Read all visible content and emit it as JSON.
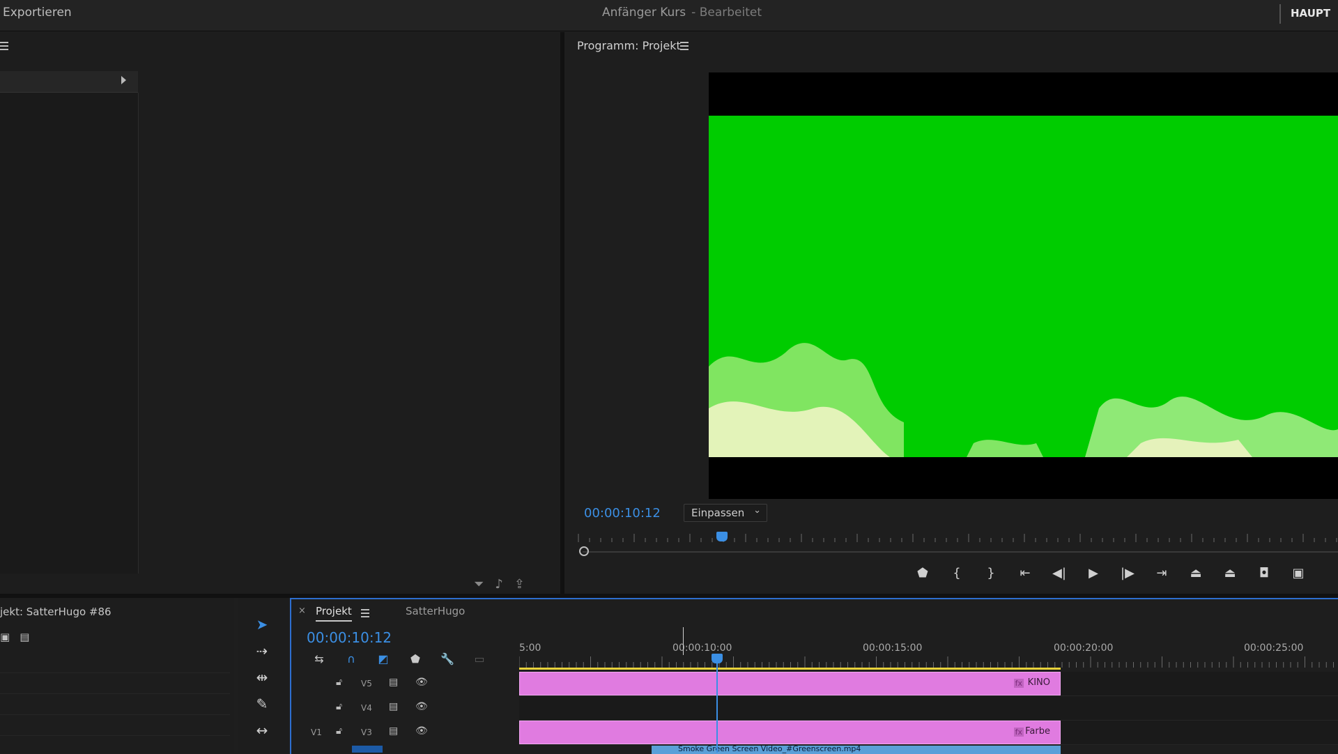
{
  "topbar": {
    "export_label": "Exportieren",
    "project_title": "Anfänger Kurs",
    "project_status": "- Bearbeitet",
    "workspace": "HAUPT"
  },
  "program_monitor": {
    "title": "Programm: Projekt",
    "timecode": "00:00:10:12",
    "fit_option": "Einpassen",
    "playhead_fraction": 0.15
  },
  "project_panel": {
    "title": "jekt: SatterHugo #86"
  },
  "timeline": {
    "tab_active": "Projekt",
    "tab_other": "SatterHugo",
    "timecode": "00:00:10:12",
    "ruler_labels": [
      "5:00",
      "00:00:10:00",
      "00:00:15:00",
      "00:00:20:00",
      "00:00:25:00"
    ],
    "tracks": [
      {
        "name": "V5",
        "source": "",
        "clip": "KINO"
      },
      {
        "name": "V4",
        "source": "",
        "clip": ""
      },
      {
        "name": "V3",
        "source": "V1",
        "clip": "Farbe"
      }
    ],
    "partial_clip": "Smoke Green Screen Video_#Greenscreen.mp4"
  },
  "colors": {
    "accent": "#3b8fe4",
    "green_screen": "#00cc00",
    "clip_pink": "#e07be0",
    "work_area": "#e8d23a"
  },
  "icons": {
    "transport": [
      "marker-icon",
      "mark-in-icon",
      "mark-out-icon",
      "go-to-in-icon",
      "step-back-icon",
      "play-icon",
      "step-forward-icon",
      "go-to-out-icon",
      "lift-icon",
      "extract-icon",
      "camera-icon",
      "compare-icon"
    ]
  }
}
